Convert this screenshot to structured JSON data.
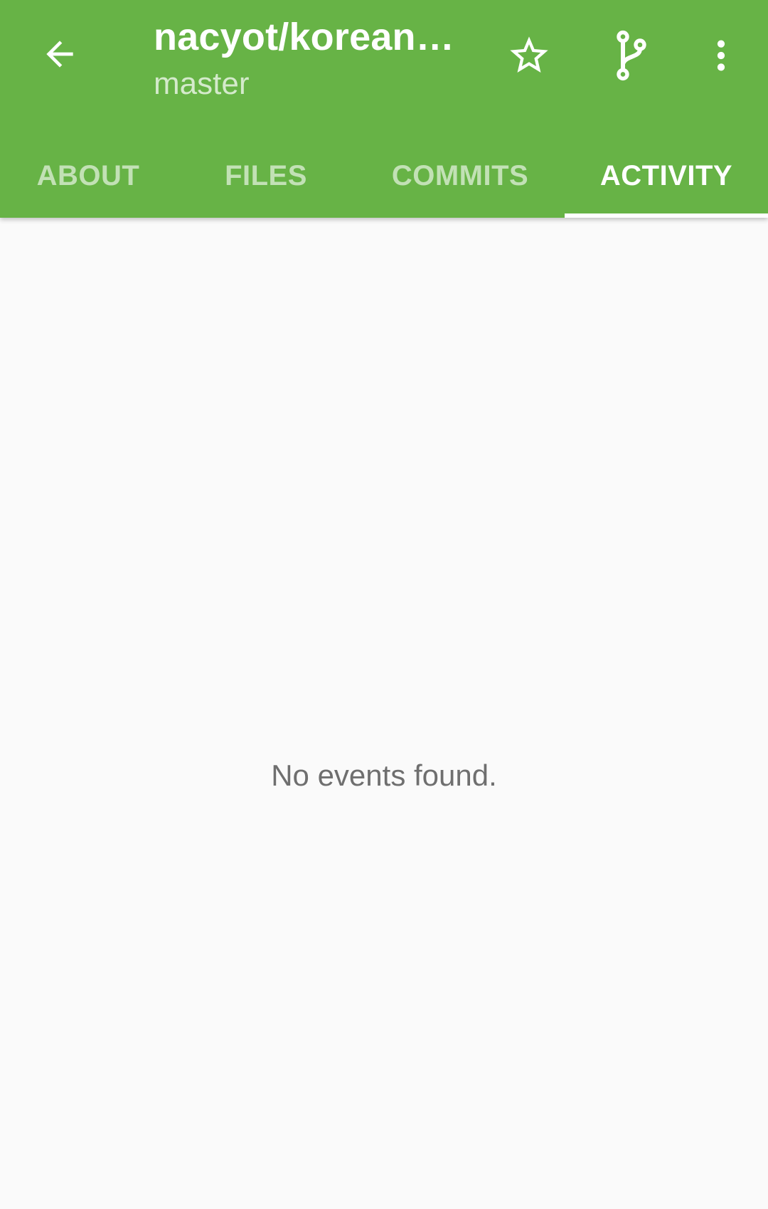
{
  "toolbar": {
    "back_icon": "arrow-left-icon",
    "title": "nacyot/korean…",
    "subtitle": "master",
    "actions": [
      {
        "name": "star",
        "icon": "star-outline-icon"
      },
      {
        "name": "branch",
        "icon": "git-branch-icon"
      },
      {
        "name": "more",
        "icon": "more-vertical-icon"
      }
    ]
  },
  "tabs": [
    {
      "label": "ABOUT",
      "active": false
    },
    {
      "label": "FILES",
      "active": false
    },
    {
      "label": "COMMITS",
      "active": false
    },
    {
      "label": "ACTIVITY",
      "active": true
    }
  ],
  "content": {
    "empty_message": "No events found."
  },
  "colors": {
    "primary": "#67b346",
    "background": "#fafafa",
    "text_secondary": "#6f6f6f"
  }
}
